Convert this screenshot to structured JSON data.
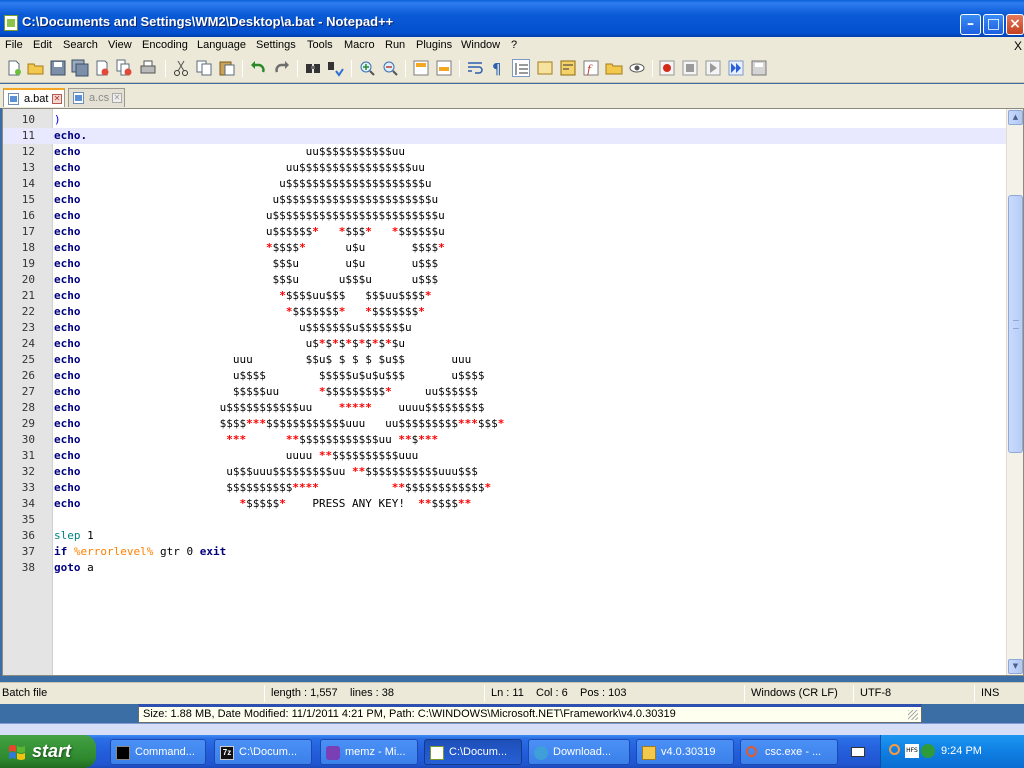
{
  "window": {
    "title": "C:\\Documents and Settings\\WM2\\Desktop\\a.bat - Notepad++"
  },
  "menu": [
    "File",
    "Edit",
    "Search",
    "View",
    "Encoding",
    "Language",
    "Settings",
    "Tools",
    "Macro",
    "Run",
    "Plugins",
    "Window",
    "?"
  ],
  "menu_close": "X",
  "tabs": [
    {
      "label": "a.bat",
      "active": true
    },
    {
      "label": "a.cs",
      "active": false
    }
  ],
  "toolbar_icons": [
    "new-file-icon",
    "open-file-icon",
    "save-icon",
    "save-all-icon",
    "close-icon",
    "close-all-icon",
    "print-icon",
    "cut-icon",
    "copy-icon",
    "paste-icon",
    "undo-icon",
    "redo-icon",
    "find-icon",
    "replace-icon",
    "zoom-in-icon",
    "zoom-out-icon",
    "sync-vertical-icon",
    "sync-horizontal-icon",
    "word-wrap-icon",
    "show-all-characters-icon",
    "indent-guide-icon",
    "user-language-icon",
    "doc-map-icon",
    "function-list-icon",
    "folder-workspace-icon",
    "monitor-icon",
    "record-macro-icon",
    "stop-macro-icon",
    "play-macro-icon",
    "play-multiple-macro-icon",
    "save-macro-icon"
  ],
  "code": {
    "current_line": 11,
    "lines": [
      {
        "n": "10",
        "segments": [
          {
            "c": "paren",
            "t": ")"
          }
        ]
      },
      {
        "n": "11",
        "segments": [
          {
            "c": "kw",
            "t": "echo."
          }
        ]
      },
      {
        "n": "12",
        "segments": [
          {
            "c": "kw",
            "t": "echo"
          },
          {
            "c": "art",
            "t": "                                  uu$$$$$$$$$$$uu"
          }
        ]
      },
      {
        "n": "13",
        "segments": [
          {
            "c": "kw",
            "t": "echo"
          },
          {
            "c": "art",
            "t": "                               uu$$$$$$$$$$$$$$$$$uu"
          }
        ]
      },
      {
        "n": "14",
        "segments": [
          {
            "c": "kw",
            "t": "echo"
          },
          {
            "c": "art",
            "t": "                              u$$$$$$$$$$$$$$$$$$$$$u"
          }
        ]
      },
      {
        "n": "15",
        "segments": [
          {
            "c": "kw",
            "t": "echo"
          },
          {
            "c": "art",
            "t": "                             u$$$$$$$$$$$$$$$$$$$$$$$u"
          }
        ]
      },
      {
        "n": "16",
        "segments": [
          {
            "c": "kw",
            "t": "echo"
          },
          {
            "c": "art",
            "t": "                            u$$$$$$$$$$$$$$$$$$$$$$$$$u"
          }
        ]
      },
      {
        "n": "17",
        "segments": [
          {
            "c": "kw",
            "t": "echo"
          },
          {
            "c": "art",
            "t": "                            u$$$$$$"
          },
          {
            "c": "star",
            "t": "*"
          },
          {
            "c": "art",
            "t": "   "
          },
          {
            "c": "star",
            "t": "*"
          },
          {
            "c": "art",
            "t": "$$$"
          },
          {
            "c": "star",
            "t": "*"
          },
          {
            "c": "art",
            "t": "   "
          },
          {
            "c": "star",
            "t": "*"
          },
          {
            "c": "art",
            "t": "$$$$$$u"
          }
        ]
      },
      {
        "n": "18",
        "segments": [
          {
            "c": "kw",
            "t": "echo"
          },
          {
            "c": "art",
            "t": "                            "
          },
          {
            "c": "star",
            "t": "*"
          },
          {
            "c": "art",
            "t": "$$$$"
          },
          {
            "c": "star",
            "t": "*"
          },
          {
            "c": "art",
            "t": "      u$u       $$$$"
          },
          {
            "c": "star",
            "t": "*"
          }
        ]
      },
      {
        "n": "19",
        "segments": [
          {
            "c": "kw",
            "t": "echo"
          },
          {
            "c": "art",
            "t": "                             $$$u       u$u       u$$$"
          }
        ]
      },
      {
        "n": "20",
        "segments": [
          {
            "c": "kw",
            "t": "echo"
          },
          {
            "c": "art",
            "t": "                             $$$u      u$$$u      u$$$"
          }
        ]
      },
      {
        "n": "21",
        "segments": [
          {
            "c": "kw",
            "t": "echo"
          },
          {
            "c": "art",
            "t": "                              "
          },
          {
            "c": "star",
            "t": "*"
          },
          {
            "c": "art",
            "t": "$$$$uu$$$   $$$uu$$$$"
          },
          {
            "c": "star",
            "t": "*"
          }
        ]
      },
      {
        "n": "22",
        "segments": [
          {
            "c": "kw",
            "t": "echo"
          },
          {
            "c": "art",
            "t": "                               "
          },
          {
            "c": "star",
            "t": "*"
          },
          {
            "c": "art",
            "t": "$$$$$$$"
          },
          {
            "c": "star",
            "t": "*"
          },
          {
            "c": "art",
            "t": "   "
          },
          {
            "c": "star",
            "t": "*"
          },
          {
            "c": "art",
            "t": "$$$$$$$"
          },
          {
            "c": "star",
            "t": "*"
          }
        ]
      },
      {
        "n": "23",
        "segments": [
          {
            "c": "kw",
            "t": "echo"
          },
          {
            "c": "art",
            "t": "                                 u$$$$$$$u$$$$$$$u"
          }
        ]
      },
      {
        "n": "24",
        "segments": [
          {
            "c": "kw",
            "t": "echo"
          },
          {
            "c": "art",
            "t": "                                  u$"
          },
          {
            "c": "star",
            "t": "*"
          },
          {
            "c": "art",
            "t": "$"
          },
          {
            "c": "star",
            "t": "*"
          },
          {
            "c": "art",
            "t": "$"
          },
          {
            "c": "star",
            "t": "*"
          },
          {
            "c": "art",
            "t": "$"
          },
          {
            "c": "star",
            "t": "*"
          },
          {
            "c": "art",
            "t": "$"
          },
          {
            "c": "star",
            "t": "*"
          },
          {
            "c": "art",
            "t": "$"
          },
          {
            "c": "star",
            "t": "*"
          },
          {
            "c": "art",
            "t": "$u"
          }
        ]
      },
      {
        "n": "25",
        "segments": [
          {
            "c": "kw",
            "t": "echo"
          },
          {
            "c": "art",
            "t": "                       uuu        $$u$ $ $ $ $u$$       uuu"
          }
        ]
      },
      {
        "n": "26",
        "segments": [
          {
            "c": "kw",
            "t": "echo"
          },
          {
            "c": "art",
            "t": "                       u$$$$        $$$$$u$u$u$$$       u$$$$"
          }
        ]
      },
      {
        "n": "27",
        "segments": [
          {
            "c": "kw",
            "t": "echo"
          },
          {
            "c": "art",
            "t": "                       $$$$$uu      "
          },
          {
            "c": "star",
            "t": "*"
          },
          {
            "c": "art",
            "t": "$$$$$$$$$"
          },
          {
            "c": "star",
            "t": "*"
          },
          {
            "c": "art",
            "t": "     uu$$$$$$"
          }
        ]
      },
      {
        "n": "28",
        "segments": [
          {
            "c": "kw",
            "t": "echo"
          },
          {
            "c": "art",
            "t": "                     u$$$$$$$$$$$uu    "
          },
          {
            "c": "star",
            "t": "*****"
          },
          {
            "c": "art",
            "t": "    uuuu$$$$$$$$$"
          }
        ]
      },
      {
        "n": "29",
        "segments": [
          {
            "c": "kw",
            "t": "echo"
          },
          {
            "c": "art",
            "t": "                     $$$$"
          },
          {
            "c": "star",
            "t": "***"
          },
          {
            "c": "art",
            "t": "$$$$$$$$$$$$uuu   uu$$$$$$$$$"
          },
          {
            "c": "star",
            "t": "***"
          },
          {
            "c": "art",
            "t": "$$$"
          },
          {
            "c": "star",
            "t": "*"
          }
        ]
      },
      {
        "n": "30",
        "segments": [
          {
            "c": "kw",
            "t": "echo"
          },
          {
            "c": "art",
            "t": "                      "
          },
          {
            "c": "star",
            "t": "***"
          },
          {
            "c": "art",
            "t": "      "
          },
          {
            "c": "star",
            "t": "**"
          },
          {
            "c": "art",
            "t": "$$$$$$$$$$$$uu "
          },
          {
            "c": "star",
            "t": "**"
          },
          {
            "c": "art",
            "t": "$"
          },
          {
            "c": "star",
            "t": "***"
          }
        ]
      },
      {
        "n": "31",
        "segments": [
          {
            "c": "kw",
            "t": "echo"
          },
          {
            "c": "art",
            "t": "                               uuuu "
          },
          {
            "c": "star",
            "t": "**"
          },
          {
            "c": "art",
            "t": "$$$$$$$$$$uuu"
          }
        ]
      },
      {
        "n": "32",
        "segments": [
          {
            "c": "kw",
            "t": "echo"
          },
          {
            "c": "art",
            "t": "                      u$$$uuu$$$$$$$$$uu "
          },
          {
            "c": "star",
            "t": "**"
          },
          {
            "c": "art",
            "t": "$$$$$$$$$$$uuu$$$"
          }
        ]
      },
      {
        "n": "33",
        "segments": [
          {
            "c": "kw",
            "t": "echo"
          },
          {
            "c": "art",
            "t": "                      $$$$$$$$$$"
          },
          {
            "c": "star",
            "t": "****"
          },
          {
            "c": "art",
            "t": "           "
          },
          {
            "c": "star",
            "t": "**"
          },
          {
            "c": "art",
            "t": "$$$$$$$$$$$$"
          },
          {
            "c": "star",
            "t": "*"
          }
        ]
      },
      {
        "n": "34",
        "segments": [
          {
            "c": "kw",
            "t": "echo"
          },
          {
            "c": "art",
            "t": "                        "
          },
          {
            "c": "star",
            "t": "*"
          },
          {
            "c": "art",
            "t": "$$$$$"
          },
          {
            "c": "star",
            "t": "*"
          },
          {
            "c": "art",
            "t": "    PRESS ANY KEY!  "
          },
          {
            "c": "star",
            "t": "**"
          },
          {
            "c": "art",
            "t": "$$$$"
          },
          {
            "c": "star",
            "t": "**"
          }
        ]
      },
      {
        "n": "35",
        "segments": []
      },
      {
        "n": "36",
        "segments": [
          {
            "c": "cmd",
            "t": "slep"
          },
          {
            "c": "plain",
            "t": " 1"
          }
        ]
      },
      {
        "n": "37",
        "segments": [
          {
            "c": "kw",
            "t": "if"
          },
          {
            "c": "plain",
            "t": " "
          },
          {
            "c": "var",
            "t": "%errorlevel%"
          },
          {
            "c": "plain",
            "t": " gtr 0 "
          },
          {
            "c": "kw",
            "t": "exit"
          }
        ]
      },
      {
        "n": "38",
        "segments": [
          {
            "c": "kw",
            "t": "goto"
          },
          {
            "c": "plain",
            "t": " a"
          }
        ]
      }
    ]
  },
  "status": {
    "file_type": "Batch file",
    "length": "length : 1,557",
    "lines": "lines : 38",
    "ln": "Ln : 11",
    "col": "Col : 6",
    "pos": "Pos : 103",
    "eol": "Windows (CR LF)",
    "encoding": "UTF-8",
    "mode": "INS"
  },
  "infobar": {
    "text": "Size: 1.88 MB, Date Modified: 11/1/2011 4:21 PM, Path: C:\\WINDOWS\\Microsoft.NET\\Framework\\v4.0.30319"
  },
  "taskbar": {
    "start_label": "start",
    "tasks": [
      {
        "label": "Command...",
        "icon": "command-prompt-icon",
        "color": "#000000"
      },
      {
        "label": "C:\\Docum...",
        "icon": "7zip-icon",
        "color": "#111111"
      },
      {
        "label": "memz - Mi...",
        "icon": "visual-studio-icon",
        "color": "#7a3fb5"
      },
      {
        "label": "C:\\Docum...",
        "icon": "notepadpp-icon",
        "color": "#8cc34a",
        "active": true
      },
      {
        "label": "Download...",
        "icon": "download-icon",
        "color": "#3f9fd8"
      },
      {
        "label": "v4.0.30319",
        "icon": "folder-icon",
        "color": "#f2c94c"
      },
      {
        "label": "csc.exe - ...",
        "icon": "search-icon",
        "color": "#e05a2b"
      }
    ],
    "clock": "9:24 PM"
  }
}
